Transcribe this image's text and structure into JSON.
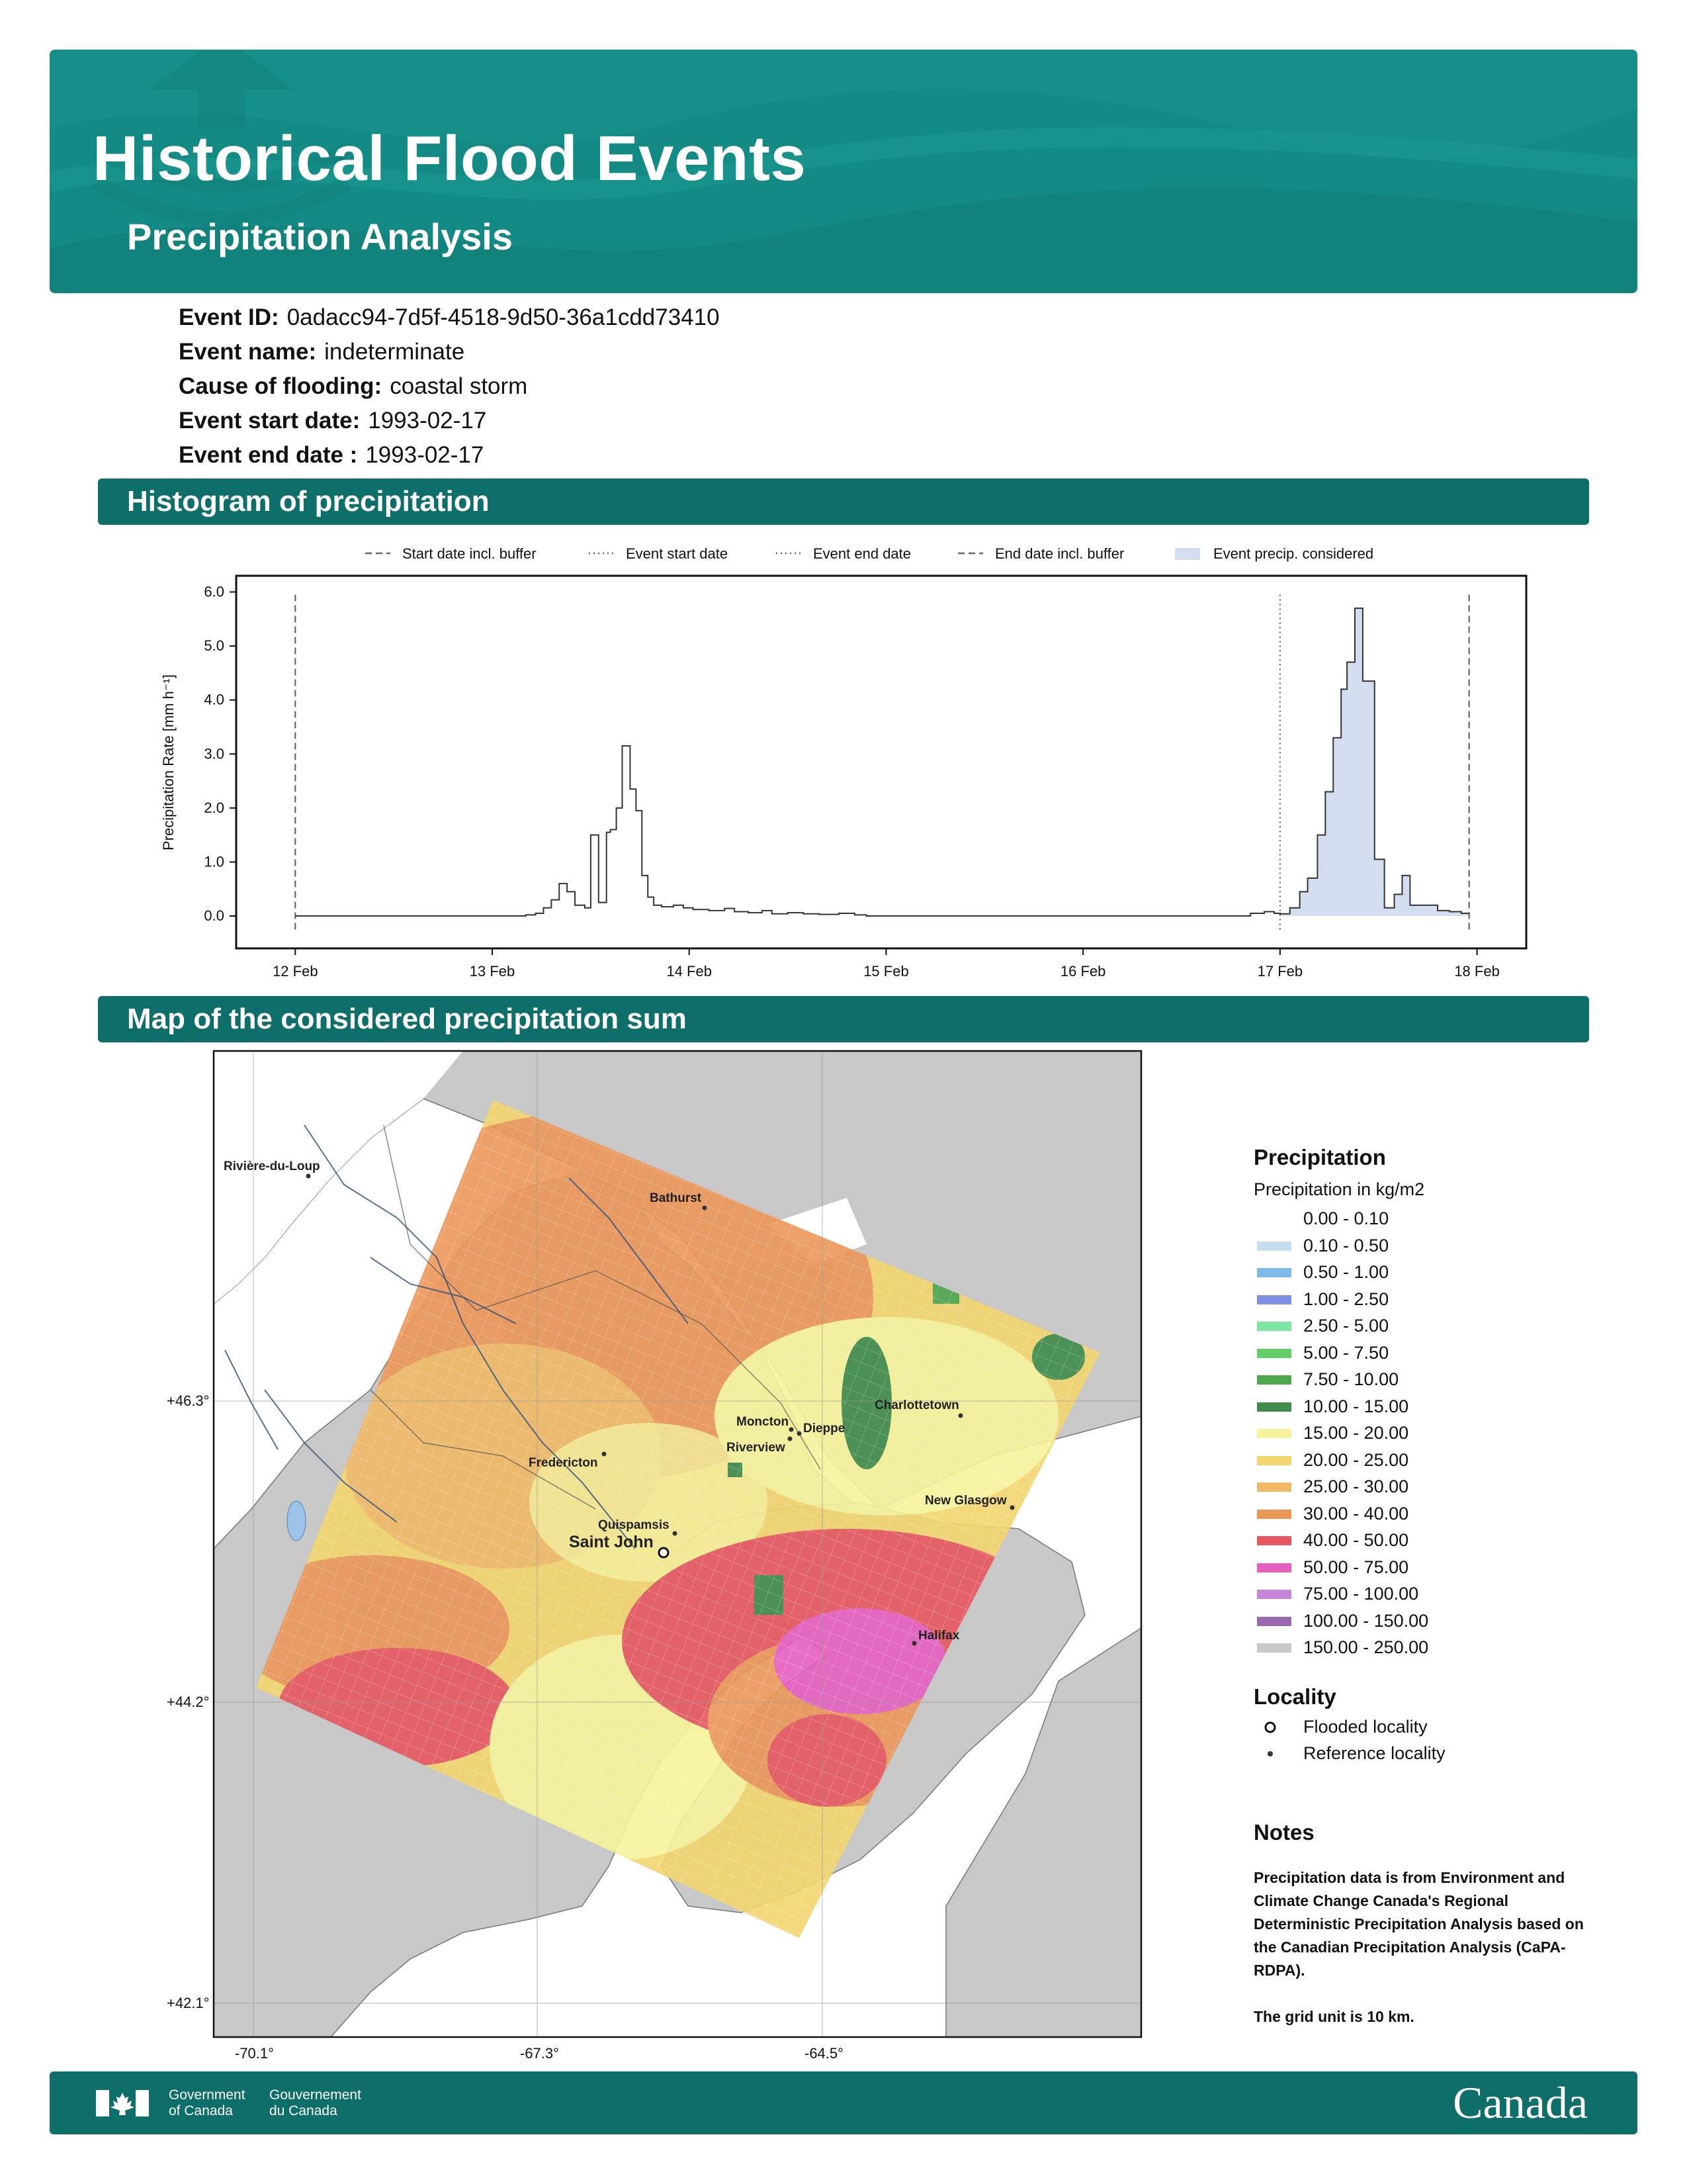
{
  "header": {
    "title": "Historical Flood Events",
    "subtitle": "Precipitation Analysis"
  },
  "event": {
    "id_label": "Event ID:",
    "id_value": "0adacc94-7d5f-4518-9d50-36a1cdd73410",
    "name_label": "Event name:",
    "name_value": "indeterminate",
    "cause_label": "Cause of flooding:",
    "cause_value": "coastal storm",
    "start_label": "Event start date:",
    "start_value": "1993-02-17",
    "end_label": "Event end date :",
    "end_value": "1993-02-17"
  },
  "sections": {
    "histogram": "Histogram of precipitation",
    "map": "Map of the considered precipitation sum"
  },
  "chart_data": {
    "type": "line",
    "ylabel": "Precipitation Rate [mm h⁻¹]",
    "ylim": [
      -0.6,
      6.3
    ],
    "yticks": [
      "0.0",
      "1.0",
      "2.0",
      "3.0",
      "4.0",
      "5.0",
      "6.0"
    ],
    "xlim": [
      11.7,
      18.25
    ],
    "xticks": [
      {
        "value": 12,
        "label": "12 Feb"
      },
      {
        "value": 13,
        "label": "13 Feb"
      },
      {
        "value": 14,
        "label": "14 Feb"
      },
      {
        "value": 15,
        "label": "15 Feb"
      },
      {
        "value": 16,
        "label": "16 Feb"
      },
      {
        "value": 17,
        "label": "17 Feb"
      },
      {
        "value": 18,
        "label": "18 Feb"
      }
    ],
    "legend": [
      "Start date incl. buffer",
      "Event start date",
      "Event end date",
      "End date incl. buffer",
      "Event precip. considered"
    ],
    "vlines": [
      {
        "x": 12.0,
        "style": "dashed",
        "label": "Start date incl. buffer"
      },
      {
        "x": 17.0,
        "style": "dotted",
        "label": "Event start date"
      },
      {
        "x": 17.0,
        "style": "dotted",
        "label": "Event end date"
      },
      {
        "x": 17.96,
        "style": "dashed",
        "label": "End date incl. buffer"
      }
    ],
    "shaded_range": [
      17.0,
      17.96
    ],
    "steps": [
      [
        12.0,
        0.0
      ],
      [
        13.1,
        0.0
      ],
      [
        13.17,
        0.02
      ],
      [
        13.22,
        0.05
      ],
      [
        13.26,
        0.15
      ],
      [
        13.3,
        0.3
      ],
      [
        13.34,
        0.6
      ],
      [
        13.38,
        0.45
      ],
      [
        13.42,
        0.2
      ],
      [
        13.47,
        0.15
      ],
      [
        13.5,
        1.5
      ],
      [
        13.54,
        0.25
      ],
      [
        13.58,
        1.55
      ],
      [
        13.6,
        1.6
      ],
      [
        13.63,
        2.0
      ],
      [
        13.66,
        3.15
      ],
      [
        13.7,
        2.35
      ],
      [
        13.73,
        1.95
      ],
      [
        13.76,
        0.75
      ],
      [
        13.79,
        0.35
      ],
      [
        13.82,
        0.2
      ],
      [
        13.86,
        0.17
      ],
      [
        13.92,
        0.2
      ],
      [
        13.97,
        0.15
      ],
      [
        14.02,
        0.12
      ],
      [
        14.1,
        0.1
      ],
      [
        14.18,
        0.14
      ],
      [
        14.23,
        0.08
      ],
      [
        14.3,
        0.06
      ],
      [
        14.37,
        0.1
      ],
      [
        14.42,
        0.04
      ],
      [
        14.5,
        0.06
      ],
      [
        14.58,
        0.04
      ],
      [
        14.66,
        0.03
      ],
      [
        14.76,
        0.05
      ],
      [
        14.84,
        0.02
      ],
      [
        14.9,
        0.0
      ],
      [
        16.75,
        0.0
      ],
      [
        16.85,
        0.05
      ],
      [
        16.92,
        0.08
      ],
      [
        16.97,
        0.05
      ],
      [
        17.0,
        0.04
      ],
      [
        17.05,
        0.15
      ],
      [
        17.1,
        0.45
      ],
      [
        17.14,
        0.7
      ],
      [
        17.19,
        1.5
      ],
      [
        17.23,
        2.3
      ],
      [
        17.27,
        3.3
      ],
      [
        17.31,
        4.2
      ],
      [
        17.34,
        4.7
      ],
      [
        17.38,
        5.7
      ],
      [
        17.42,
        4.35
      ],
      [
        17.48,
        1.05
      ],
      [
        17.53,
        0.15
      ],
      [
        17.58,
        0.4
      ],
      [
        17.62,
        0.75
      ],
      [
        17.66,
        0.2
      ],
      [
        17.72,
        0.2
      ],
      [
        17.76,
        0.2
      ],
      [
        17.8,
        0.1
      ],
      [
        17.86,
        0.08
      ],
      [
        17.92,
        0.05
      ],
      [
        17.96,
        0.04
      ]
    ]
  },
  "map": {
    "lat_labels": [
      "+46.3°",
      "+44.2°",
      "+42.1°"
    ],
    "lon_labels": [
      "-70.1°",
      "-67.3°",
      "-64.5°"
    ],
    "places": {
      "riviere": "Rivière-du-Loup",
      "bathurst": "Bathurst",
      "charlottetown": "Charlottetown",
      "moncton": "Moncton",
      "dieppe": "Dieppe",
      "riverview": "Riverview",
      "fredericton": "Fredericton",
      "newglasgow": "New Glasgow",
      "quispamsis": "Quispamsis",
      "saintjohn": "Saint John",
      "halifax": "Halifax"
    }
  },
  "legend": {
    "precip_title": "Precipitation",
    "precip_subtitle": "Precipitation in kg/m2",
    "bins": [
      {
        "label": "0.00 - 0.10",
        "color": "#ffffff"
      },
      {
        "label": "0.10 - 0.50",
        "color": "#c6dcf0"
      },
      {
        "label": "0.50 - 1.00",
        "color": "#7fb9e8"
      },
      {
        "label": "1.00 - 2.50",
        "color": "#7f8fe6"
      },
      {
        "label": "2.50 - 5.00",
        "color": "#7ee6a4"
      },
      {
        "label": "5.00 - 7.50",
        "color": "#66cc6a"
      },
      {
        "label": "7.50 - 10.00",
        "color": "#4ea64f"
      },
      {
        "label": "10.00 - 15.00",
        "color": "#3f8b4a"
      },
      {
        "label": "15.00 - 20.00",
        "color": "#f6f39a"
      },
      {
        "label": "20.00 - 25.00",
        "color": "#f2d56e"
      },
      {
        "label": "25.00 - 30.00",
        "color": "#f0b966"
      },
      {
        "label": "30.00 - 40.00",
        "color": "#eb9657"
      },
      {
        "label": "40.00 - 50.00",
        "color": "#e65760"
      },
      {
        "label": "50.00 - 75.00",
        "color": "#e55fbf"
      },
      {
        "label": "75.00 - 100.00",
        "color": "#c785d8"
      },
      {
        "label": "100.00 - 150.00",
        "color": "#9a6aae"
      },
      {
        "label": "150.00 - 250.00",
        "color": "#c8c8c8"
      }
    ],
    "locality_title": "Locality",
    "flooded": "Flooded locality",
    "reference": "Reference locality",
    "notes_title": "Notes",
    "notes_body": "Precipitation data is from Environment and Climate Change Canada's Regional Deterministic Precipitation Analysis based on the Canadian Precipitation Analysis (CaPA-RDPA).",
    "grid_unit": "The grid unit is 10 km."
  },
  "footer": {
    "gov_en_1": "Government",
    "gov_en_2": "of Canada",
    "gov_fr_1": "Gouvernement",
    "gov_fr_2": "du Canada",
    "wordmark": "Canada"
  }
}
